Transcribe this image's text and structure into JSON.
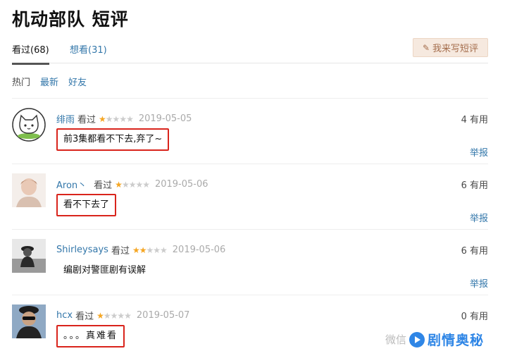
{
  "page": {
    "title": "机动部队 短评"
  },
  "tabs": [
    {
      "label": "看过(68)"
    },
    {
      "label": "想看(31)"
    }
  ],
  "write_button": {
    "label": "我来写短评",
    "icon": "pencil-icon"
  },
  "filters": [
    {
      "label": "热门"
    },
    {
      "label": "最新"
    },
    {
      "label": "好友"
    }
  ],
  "comments": [
    {
      "user": "绯雨",
      "status": "看过",
      "rating": 1,
      "date": "2019-05-05",
      "votes": "4 有用",
      "text": "前3集都看不下去,弃了~",
      "report": "举报"
    },
    {
      "user": "Aron丶",
      "status": "看过",
      "rating": 1,
      "date": "2019-05-06",
      "votes": "6 有用",
      "text": "看不下去了",
      "report": "举报"
    },
    {
      "user": "Shirleysays",
      "status": "看过",
      "rating": 2,
      "date": "2019-05-06",
      "votes": "6 有用",
      "text": "编剧对警匪剧有误解",
      "report": "举报"
    },
    {
      "user": "hcx",
      "status": "看过",
      "rating": 1,
      "date": "2019-05-07",
      "votes": "0 有用",
      "text": "。。。真难看",
      "report": ""
    }
  ],
  "watermark": {
    "prefix": "微信",
    "name": "剧情奥秘"
  },
  "colors": {
    "link": "#3377aa",
    "highlight_border": "#d9241c",
    "star": "#f5a623",
    "button_bg": "#f6e9df"
  }
}
